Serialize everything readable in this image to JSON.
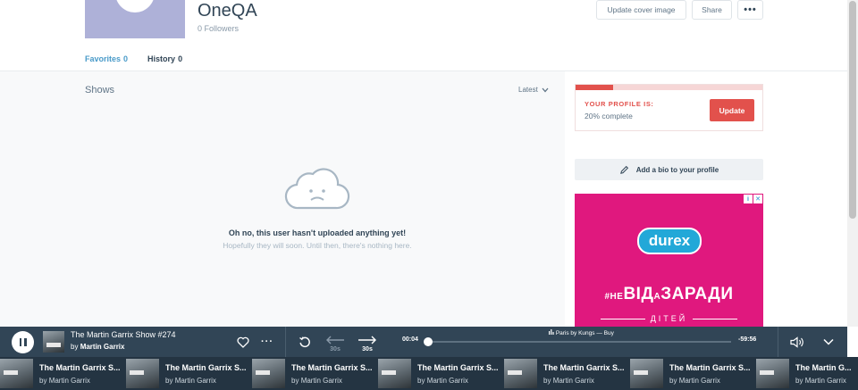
{
  "profile": {
    "name": "OneQA",
    "followers": "0 Followers",
    "buttons": {
      "cover": "Update cover image",
      "share": "Share",
      "more": "•••"
    }
  },
  "tabs": [
    {
      "label": "Favorites",
      "count": "0"
    },
    {
      "label": "History",
      "count": "0"
    }
  ],
  "shows": {
    "title": "Shows",
    "sort": "Latest",
    "empty_title": "Oh no, this user hasn't uploaded anything yet!",
    "empty_sub": "Hopefully they will soon. Until then, there's nothing here."
  },
  "profile_status": {
    "label": "YOUR PROFILE IS:",
    "percent_text": "20% complete",
    "percent": 0.2,
    "button": "Update"
  },
  "bio": {
    "label": "Add a bio to your profile"
  },
  "ad": {
    "logo": "durex",
    "slogan_pre": "#НЕ",
    "slogan_mid": "ВІД",
    "slogan_small": "А",
    "slogan_post": "ЗАРАДИ",
    "sub": "ДІТЕЙ"
  },
  "player": {
    "title": "The Martin Garrix Show #274",
    "by": "by",
    "artist": "Martin Garrix",
    "elapsed": "00:04",
    "remaining": "-59:56",
    "now_playing": "Paris by Kungs — Buy",
    "progress": 0.001,
    "rewind_label": "30s",
    "forward_label": "30s"
  },
  "queue": [
    {
      "title": "The Martin Garrix S...",
      "by": "by",
      "artist": "Martin Garrix"
    },
    {
      "title": "The Martin Garrix S...",
      "by": "by",
      "artist": "Martin Garrix"
    },
    {
      "title": "The Martin Garrix S...",
      "by": "by",
      "artist": "Martin Garrix"
    },
    {
      "title": "The Martin Garrix S...",
      "by": "by",
      "artist": "Martin Garrix"
    },
    {
      "title": "The Martin Garrix S...",
      "by": "by",
      "artist": "Martin Garrix"
    },
    {
      "title": "The Martin Garrix S...",
      "by": "by",
      "artist": "Martin Garrix"
    },
    {
      "title": "The Martin G...",
      "by": "by",
      "artist": "Martin Garrix"
    }
  ],
  "icons": [
    "heart-icon",
    "more-icon",
    "replay-icon",
    "rewind-30-icon",
    "forward-30-icon",
    "volume-icon",
    "chevron-down-icon",
    "pencil-icon",
    "sad-cloud-icon",
    "equalizer-icon"
  ]
}
